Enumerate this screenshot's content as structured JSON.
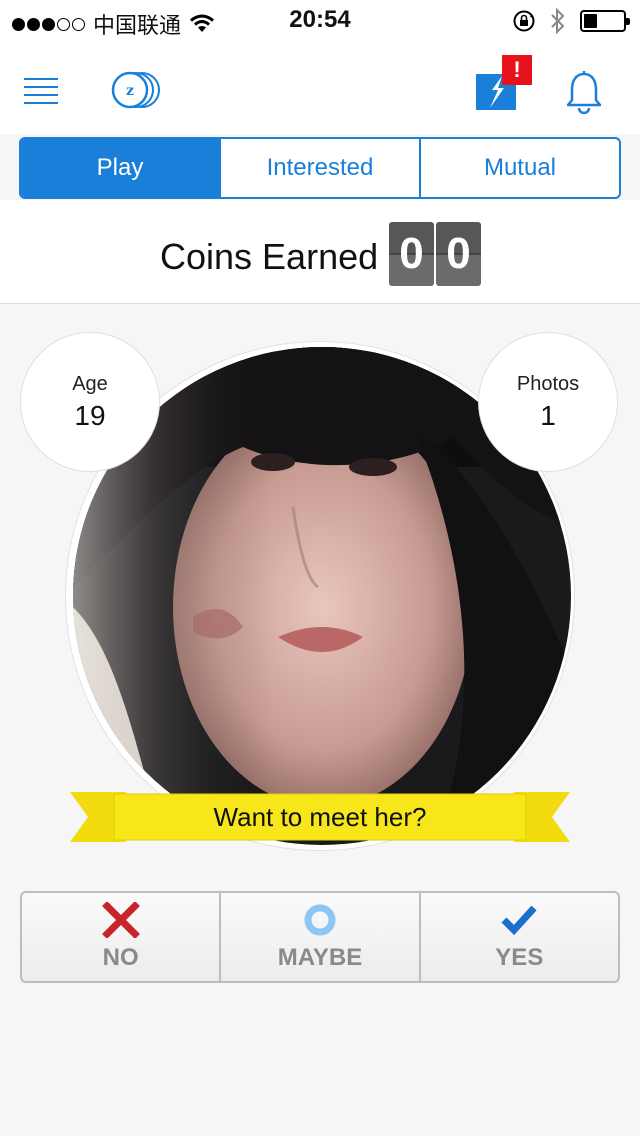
{
  "status_bar": {
    "carrier": "中国联通",
    "time": "20:54",
    "battery_level": 0.35,
    "signal_bars_filled": 3,
    "signal_bars_total": 5
  },
  "nav": {
    "logo_letter": "z",
    "alert_badge": "!"
  },
  "tabs": [
    {
      "label": "Play",
      "active": true
    },
    {
      "label": "Interested",
      "active": false
    },
    {
      "label": "Mutual",
      "active": false
    }
  ],
  "coins": {
    "label": "Coins Earned",
    "digits": [
      "0",
      "0"
    ]
  },
  "profile": {
    "age_label": "Age",
    "age": "19",
    "photos_label": "Photos",
    "photos": "1",
    "prompt": "Want to meet her?"
  },
  "actions": {
    "no": "NO",
    "maybe": "MAYBE",
    "yes": "YES"
  },
  "colors": {
    "accent": "#1a7fd8",
    "ribbon": "#f7e61a",
    "no": "#c8242a",
    "maybe": "#8ec5f2",
    "yes": "#1a6fcf",
    "alert": "#e8121b"
  }
}
